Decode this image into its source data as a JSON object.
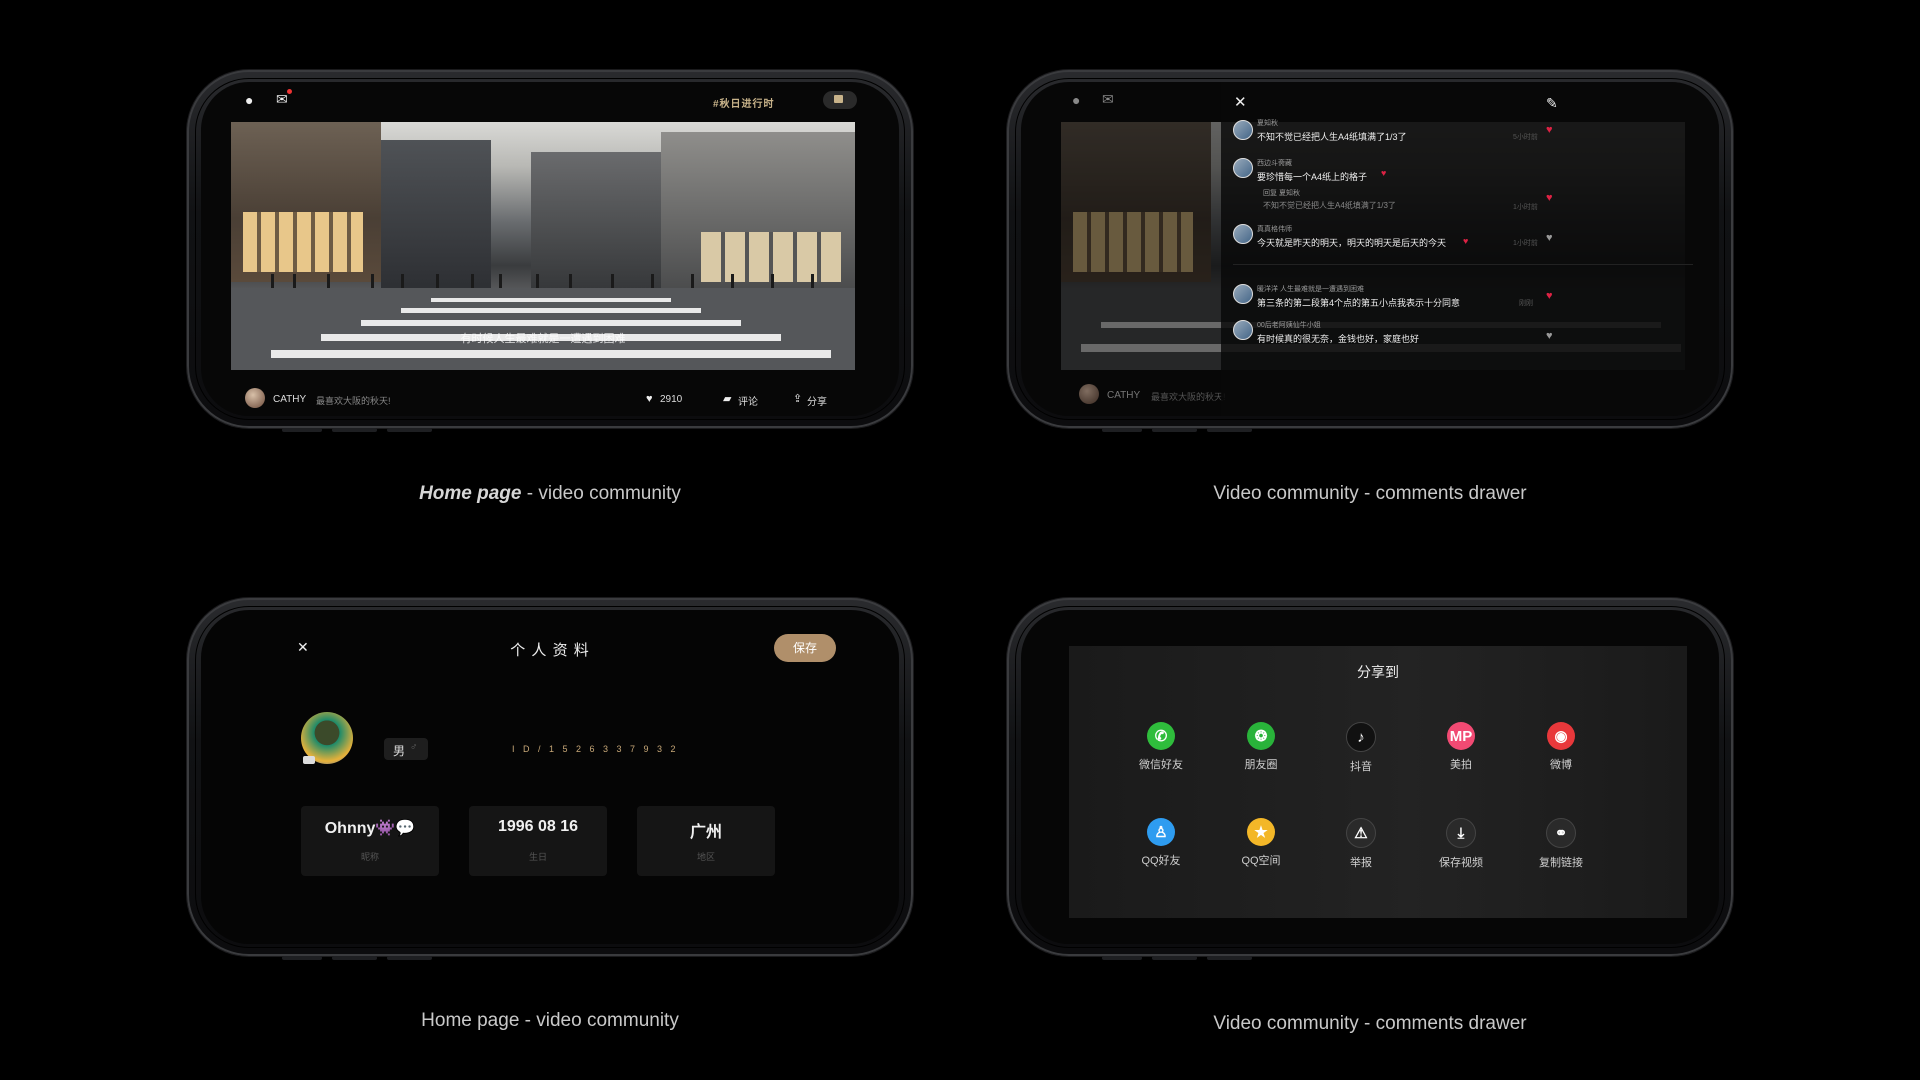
{
  "captions": {
    "tl_bold": "Home page",
    "tl_rest": " - video community",
    "tr": "Video community  - comments drawer",
    "bl": "Home page - video community",
    "br": "Video community  - comments drawer"
  },
  "home": {
    "hashtag": "#秋日进行时",
    "subtitle": "有时候人生最难就是一遭遇到困难",
    "username": "CATHY",
    "caption": "最喜欢大阪的秋天!",
    "likes": "2910",
    "comment_label": "评论",
    "share_label": "分享"
  },
  "comments_drawer": {
    "username": "CATHY",
    "caption": "最喜欢大阪的秋天!",
    "comments": [
      {
        "user": "夏知秋",
        "text": "不知不觉已经把人生A4纸填满了1/3了",
        "time": "5小时前"
      },
      {
        "user": "西边斗斋藏",
        "text": "要珍惜每一个A4纸上的格子",
        "time": ""
      },
      {
        "user": "回复 夏知秋",
        "text": "不知不觉已经把人生A4纸填满了1/3了",
        "time": "1小时前"
      },
      {
        "user": "真真格伟师",
        "text": "今天就是昨天的明天，明天的明天是后天的今天",
        "time": "1小时前"
      },
      {
        "user": "暖洋洋 人生最难就是一遭遇到困难",
        "text": "第三条的第二段第4个点的第五小点我表示十分同意",
        "time": "刚刚"
      },
      {
        "user": "00后老阿姨仙牛小姐",
        "text": "有时候真的很无奈，金钱也好，家庭也好",
        "time": ""
      }
    ]
  },
  "profile": {
    "title": "个 人 资 料",
    "save": "保存",
    "gender": "男",
    "id_digits": "I D / 1 5 2 6 3 3 7 9 3 2",
    "nickname": "Ohnny👾💬",
    "nickname_label": "昵称",
    "birthday": "1996 08 16",
    "birthday_label": "生日",
    "region": "广州",
    "region_label": "地区"
  },
  "share": {
    "title": "分享到",
    "row1": [
      {
        "label": "微信好友",
        "color": "#2fbd3c",
        "glyph": "✆",
        "icon": "wechat-icon"
      },
      {
        "label": "朋友圈",
        "color": "#29b33a",
        "glyph": "❂",
        "icon": "moments-icon"
      },
      {
        "label": "抖音",
        "color": "#111111",
        "glyph": "♪",
        "icon": "douyin-icon"
      },
      {
        "label": "美拍",
        "color": "#f14a73",
        "glyph": "MP",
        "icon": "meipai-icon"
      },
      {
        "label": "微博",
        "color": "#e8383b",
        "glyph": "◉",
        "icon": "weibo-icon"
      }
    ],
    "row2": [
      {
        "label": "QQ好友",
        "color": "#2e9cf0",
        "glyph": "♙",
        "icon": "qq-icon"
      },
      {
        "label": "QQ空间",
        "color": "#f3b728",
        "glyph": "★",
        "icon": "qzone-icon"
      },
      {
        "label": "举报",
        "color": "#2a2a2a",
        "glyph": "⚠",
        "icon": "report-icon"
      },
      {
        "label": "保存视频",
        "color": "#2a2a2a",
        "glyph": "⤓",
        "icon": "download-icon"
      },
      {
        "label": "复制链接",
        "color": "#2a2a2a",
        "glyph": "⚭",
        "icon": "link-icon"
      }
    ]
  }
}
